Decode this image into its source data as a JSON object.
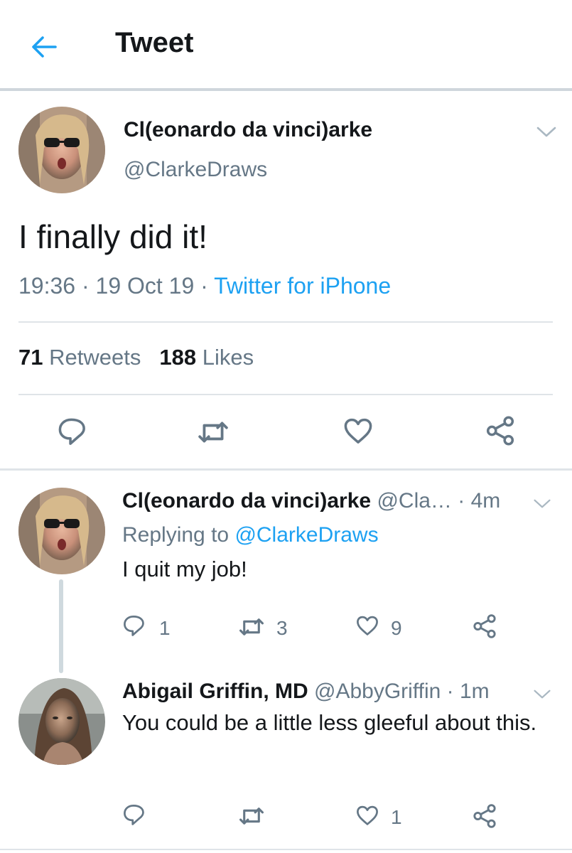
{
  "header": {
    "title": "Tweet"
  },
  "main_tweet": {
    "author_name": "Cl(eonardo da vinci)arke",
    "author_handle": "@ClarkeDraws",
    "text": "I finally did it!",
    "time": "19:36",
    "date": "19 Oct 19",
    "separator": " · ",
    "source": "Twitter for iPhone",
    "retweet_count": "71",
    "retweet_label": "Retweets",
    "like_count": "188",
    "like_label": "Likes"
  },
  "replies": [
    {
      "author_name": "Cl(eonardo da vinci)arke",
      "author_handle": "@Cla…",
      "time": " · 4m",
      "replying_prefix": "Replying to ",
      "replying_mention": "@ClarkeDraws",
      "text": "I quit my job!",
      "reply_count": "1",
      "retweet_count": "3",
      "like_count": "9"
    },
    {
      "author_name": "Abigail Griffin, MD",
      "author_handle": "@AbbyGriffin",
      "time": " · 1m",
      "text": "You could be a little less gleeful about this.",
      "like_count": "1"
    }
  ],
  "colors": {
    "accent": "#1da1f2",
    "secondary_text": "#657786",
    "primary_text": "#14171a"
  },
  "icons": [
    "back-arrow-icon",
    "chevron-down-icon",
    "reply-icon",
    "retweet-icon",
    "like-icon",
    "share-icon"
  ]
}
